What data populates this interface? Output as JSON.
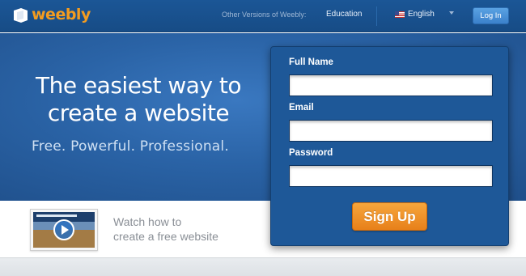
{
  "header": {
    "logo_text": "weebly",
    "other_versions_label": "Other Versions of Weebly:",
    "education_link": "Education",
    "language": {
      "label": "English",
      "flag": "us-flag-icon"
    },
    "login_label": "Log In"
  },
  "hero": {
    "headline_line1": "The easiest way to",
    "headline_line2": "create a website",
    "tagline": "Free. Powerful. Professional."
  },
  "video": {
    "line1": "Watch how to",
    "line2": "create a free website"
  },
  "signup": {
    "full_name_label": "Full Name",
    "full_name_value": "",
    "email_label": "Email",
    "email_value": "",
    "password_label": "Password",
    "password_value": "",
    "submit_label": "Sign Up"
  },
  "colors": {
    "topbar": "#1b5696",
    "hero": "#2a63a6",
    "panel": "#1e5898",
    "brand_orange": "#f39c20",
    "signup_button": "#f0921f",
    "login_button": "#4a92d8"
  }
}
